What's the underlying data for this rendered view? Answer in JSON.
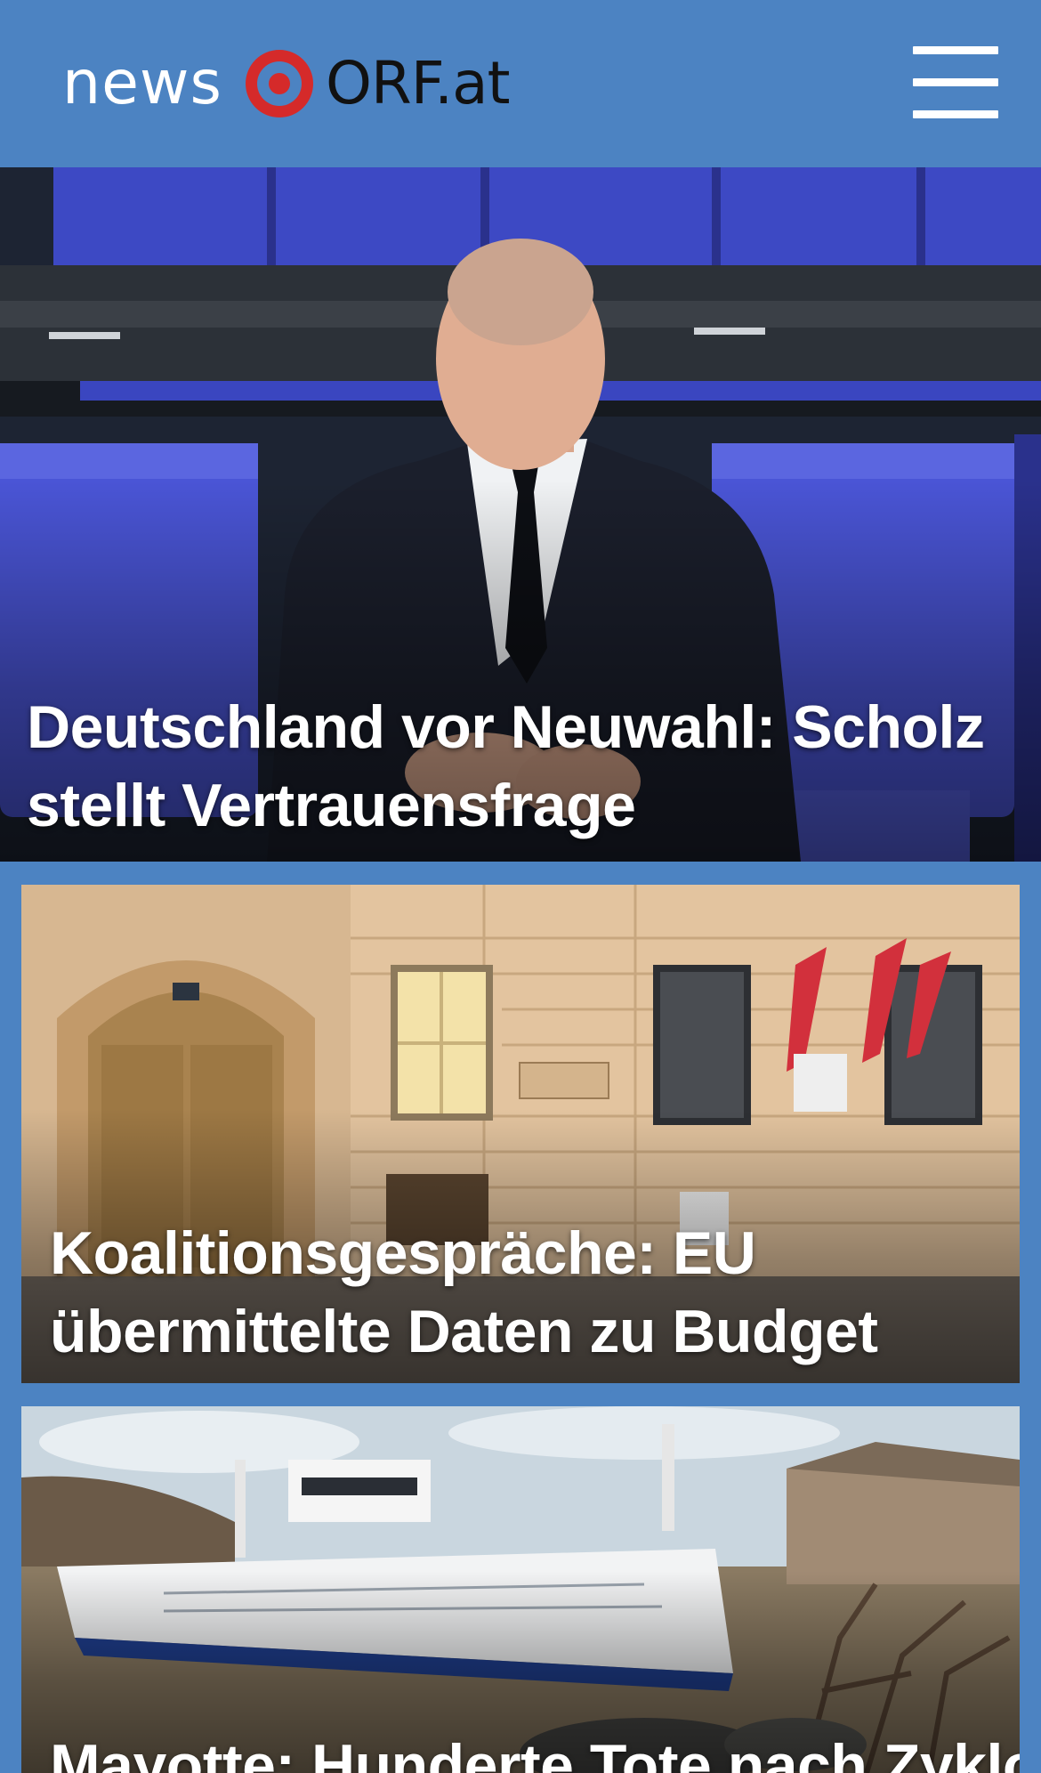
{
  "header": {
    "logo_news": "news",
    "logo_orf": "ORF.at",
    "menu_icon": "hamburger-menu-icon",
    "colors": {
      "background": "#4c83c2",
      "logo_red": "#d52a2a"
    }
  },
  "stories": [
    {
      "headline": "Deutschland vor Neuwahl: Scholz stellt Vertrauensfrage"
    },
    {
      "headline": "Koalitionsgespräche: EU übermittelte Daten zu Budget"
    },
    {
      "headline": "Mayotte: Hunderte Tote nach Zyklon"
    }
  ]
}
